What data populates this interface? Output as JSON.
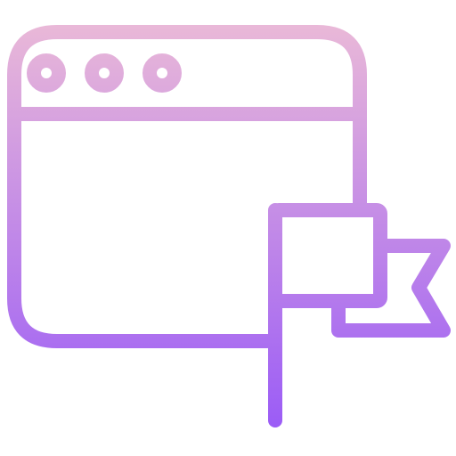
{
  "icon": {
    "name": "browser-window-flag-icon",
    "gradient_top": "#e9b8d8",
    "gradient_bottom": "#9b5cf6"
  }
}
